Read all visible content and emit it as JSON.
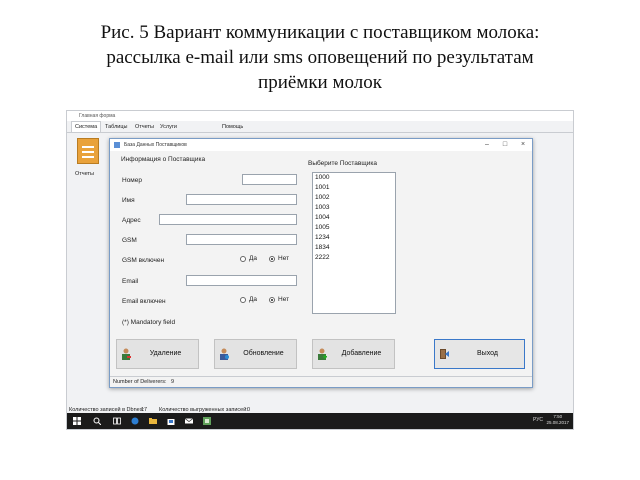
{
  "caption": {
    "line1": "Рис. 5 Вариант коммуникации с поставщиком молока:",
    "line2": "рассылка e-mail или sms оповещений по результатам",
    "line3": "приёмки молок"
  },
  "outer_window": {
    "title": "Главная форма",
    "menu": [
      "Система",
      "Таблицы",
      "Отчеты",
      "Услуги",
      "Помощь"
    ],
    "reports_label": "Отчеты",
    "status_left_label": "Количество записей в Dbnes:",
    "status_left_value": "17",
    "status_right_label": "Количество выгруженных записей:",
    "status_right_value": "0"
  },
  "dialog": {
    "title": "База Данных Поставщиков",
    "group_title": "Информация о Поставщика",
    "labels": {
      "number": "Номер",
      "name": "Имя",
      "address": "Адрес",
      "gsm": "GSM",
      "gsm_enabled": "GSM включен",
      "email": "Email",
      "email_enabled": "Email включен",
      "mandatory": "(*) Mandatory field"
    },
    "values": {
      "number": "",
      "name": "",
      "address": "",
      "gsm": "",
      "email": ""
    },
    "radio": {
      "yes": "Да",
      "no": "Нет",
      "gsm_selected": "no",
      "email_selected": "no"
    },
    "list_title": "Выберите Поставщика",
    "suppliers": [
      "1000",
      "1001",
      "1002",
      "1003",
      "1004",
      "1005",
      "1234",
      "1834",
      "2222"
    ],
    "buttons": {
      "delete": "Удаление",
      "update": "Обновление",
      "add": "Добавление",
      "exit": "Выход"
    },
    "status_label": "Number of Deliverers:",
    "status_value": "9"
  },
  "taskbar": {
    "lang": "РУС",
    "time": "7:50",
    "date": "25.08.2017"
  },
  "colors": {
    "accent": "#3a78c9",
    "taskbar": "#1b1b1b",
    "folder": "#e9a23b"
  }
}
